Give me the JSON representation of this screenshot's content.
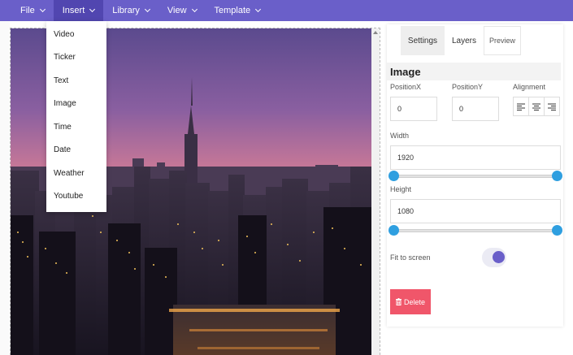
{
  "menubar": {
    "items": [
      {
        "label": "File"
      },
      {
        "label": "Insert"
      },
      {
        "label": "Library"
      },
      {
        "label": "View"
      },
      {
        "label": "Template"
      }
    ],
    "color": "#6a5fc9"
  },
  "insert_menu": {
    "items": [
      {
        "label": "Video"
      },
      {
        "label": "Ticker"
      },
      {
        "label": "Text"
      },
      {
        "label": "Image"
      },
      {
        "label": "Time"
      },
      {
        "label": "Date"
      },
      {
        "label": "Weather"
      },
      {
        "label": "Youtube"
      }
    ]
  },
  "panel": {
    "tabs": [
      {
        "label": "Settings"
      },
      {
        "label": "Layers"
      },
      {
        "label": "Preview"
      }
    ],
    "section_title": "Image",
    "position_x": {
      "label": "PositionX",
      "value": "0"
    },
    "position_y": {
      "label": "PositionY",
      "value": "0"
    },
    "alignment": {
      "label": "Alignment"
    },
    "width": {
      "label": "Width",
      "value": "1920"
    },
    "height": {
      "label": "Height",
      "value": "1080"
    },
    "fit_to_screen": {
      "label": "Fit to screen",
      "enabled": true
    },
    "delete_label": "Delete",
    "accent": "#2f9fe0",
    "delete_color": "#f0566a"
  }
}
